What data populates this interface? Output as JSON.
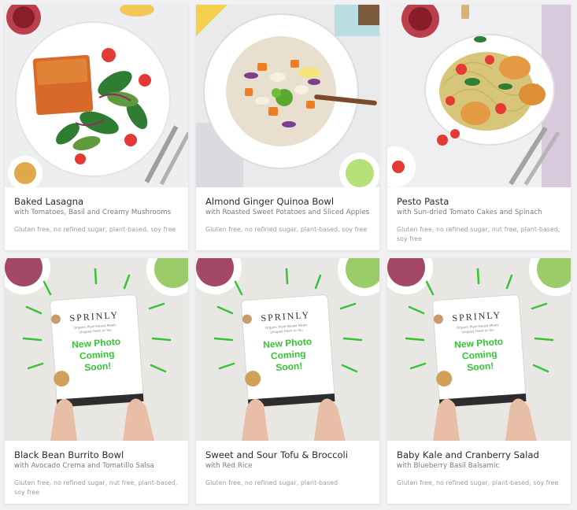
{
  "menu": {
    "items": [
      {
        "title": "Baked Lasagna",
        "subtitle": "with Tomatoes, Basil and Creamy Mushrooms",
        "tags": "Gluten free, no refined sugar, plant-based, soy free",
        "image": "lasagna-plate-photo"
      },
      {
        "title": "Almond Ginger Quinoa Bowl",
        "subtitle": "with Roasted Sweet Potatoes and Sliced Apples",
        "tags": "Gluten free, no refined sugar, plant-based, soy free",
        "image": "quinoa-bowl-photo"
      },
      {
        "title": "Pesto Pasta",
        "subtitle": "with Sun-dried Tomato Cakes and Spinach",
        "tags": "Gluten free, no refined sugar, nut free, plant-based, soy free",
        "image": "pesto-pasta-photo"
      },
      {
        "title": "Black Bean Burrito Bowl",
        "subtitle": "with Avocado Crema and Tomatillo Salsa",
        "tags": "Gluten free, no refined sugar, nut free, plant-based, soy free",
        "image": "coming-soon-placeholder"
      },
      {
        "title": "Sweet and Sour Tofu & Broccoli",
        "subtitle": "with Red Rice",
        "tags": "Gluten free, no refined sugar, plant-based",
        "image": "coming-soon-placeholder"
      },
      {
        "title": "Baby Kale and Cranberry Salad",
        "subtitle": "with Blueberry Basil Balsamic",
        "tags": "Gluten free, no refined sugar, plant-based, soy free",
        "image": "coming-soon-placeholder"
      }
    ]
  },
  "placeholder": {
    "brand": "SPRINLY",
    "tagline_1": "Organic Plant-Based Meals",
    "tagline_2": "Shipped Fresh to You",
    "line_1": "New Photo",
    "line_2": "Coming",
    "line_3": "Soon!"
  },
  "colors": {
    "background": "#f1f1f3",
    "coming_soon_green": "#35c435",
    "title_text": "#2c2c2c",
    "subtitle_text": "#7a7a7a",
    "tag_text": "#9a9a9a"
  }
}
